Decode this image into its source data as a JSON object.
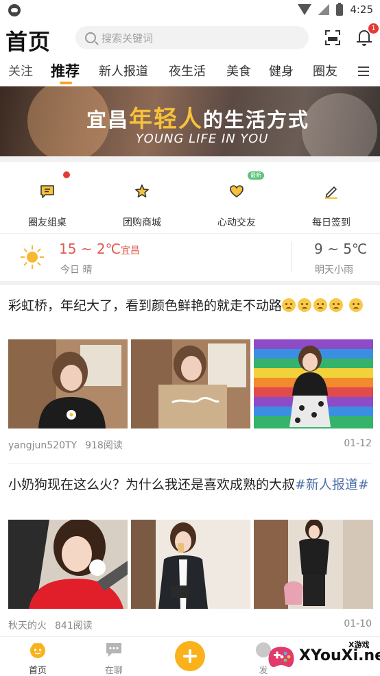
{
  "status_bar": {
    "time": "4:25"
  },
  "header": {
    "title": "首页",
    "search_placeholder": "搜索关键词",
    "notification_count": "1"
  },
  "tabs": [
    {
      "label": "关注"
    },
    {
      "label": "推荐"
    },
    {
      "label": "新人报道"
    },
    {
      "label": "夜生活"
    },
    {
      "label": "美食"
    },
    {
      "label": "健身"
    },
    {
      "label": "圈友"
    }
  ],
  "banner": {
    "line1_pre": "宜昌",
    "line1_highlight": "年轻人",
    "line1_post": "的生活方式",
    "line2": "YOUNG  LIFE  IN YOU"
  },
  "shortcuts": [
    {
      "label": "圈友组桌",
      "icon": "message-square-icon"
    },
    {
      "label": "团购商城",
      "icon": "star-icon"
    },
    {
      "label": "心动交友",
      "icon": "heart-icon",
      "tag": "最新"
    },
    {
      "label": "每日签到",
      "icon": "pencil-icon"
    }
  ],
  "weather": {
    "today_temp": "15 ~ 2℃",
    "city": "宜昌",
    "today_label": "今日 晴",
    "tomorrow_temp": "9 ~ 5℃",
    "tomorrow_label": "明天小雨"
  },
  "posts": [
    {
      "title": "彩虹桥，年纪大了，看到颜色鲜艳的就走不动路",
      "emoji_count": 5,
      "author": "yangjun520TY",
      "reads": "918阅读",
      "date": "01-12"
    },
    {
      "title": "小奶狗现在这么火？为什么我还是喜欢成熟的大叔",
      "tag": "#新人报道#",
      "author": "秋天的火",
      "reads": "841阅读",
      "date": "01-10"
    }
  ],
  "bottom_nav": [
    {
      "label": "首页"
    },
    {
      "label": "在聊"
    },
    {
      "label": "发"
    }
  ],
  "watermark": {
    "small": "X游戏",
    "big": "XYouXi.net"
  },
  "colors": {
    "accent": "#f9b21b",
    "red": "#e53935",
    "weather_red": "#e25a4f",
    "tag_blue": "#4a6fa5"
  }
}
